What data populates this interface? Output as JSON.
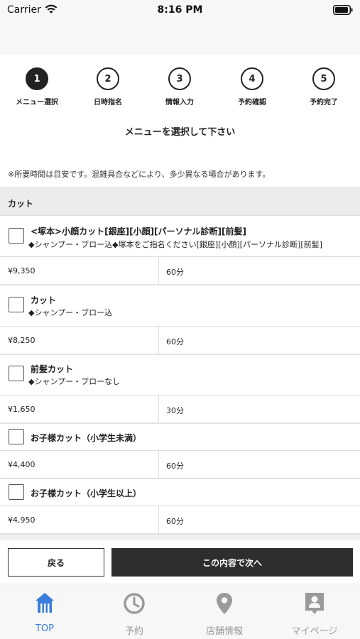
{
  "status_bar": {
    "carrier": "Carrier",
    "time": "8:16 PM"
  },
  "steps": [
    {
      "number": "1",
      "label": "メニュー選択",
      "active": true
    },
    {
      "number": "2",
      "label": "日時指名",
      "active": false
    },
    {
      "number": "3",
      "label": "情報入力",
      "active": false
    },
    {
      "number": "4",
      "label": "予約確認",
      "active": false
    },
    {
      "number": "5",
      "label": "予約完了",
      "active": false
    }
  ],
  "page_title": "メニューを選択して下さい",
  "note": "※所要時間は目安です。混雑具合などにより、多少異なる場合があります。",
  "category": "カット",
  "menu_items": [
    {
      "name": "<塚本>小顔カット[銀座][小顔][パーソナル診断][前髪]",
      "description": "◆シャンプー・ブロー込◆塚本をご指名ください[銀座][小顔][パーソナル診断][前髪]",
      "price": "¥9,350",
      "duration": "60分",
      "checked": false
    },
    {
      "name": "カット",
      "description": "◆シャンプー・ブロー込",
      "price": "¥8,250",
      "duration": "60分",
      "checked": false
    },
    {
      "name": "前髪カット",
      "description": "◆シャンプー・ブローなし",
      "price": "¥1,650",
      "duration": "30分",
      "checked": false
    },
    {
      "name": "お子様カット（小学生未満）",
      "description": "",
      "price": "¥4,400",
      "duration": "60分",
      "checked": false
    },
    {
      "name": "お子様カット（小学生以上）",
      "description": "",
      "price": "¥4,950",
      "duration": "60分",
      "checked": false
    }
  ],
  "buttons": {
    "back": "戻る",
    "next": "この内容で次へ"
  },
  "tab_bar": {
    "active_color": "#3b7ddd",
    "inactive_color": "#9a9a9a",
    "tabs": [
      {
        "label": "TOP",
        "icon": "home-icon",
        "active": true
      },
      {
        "label": "予約",
        "icon": "clock-icon",
        "active": false
      },
      {
        "label": "店舗情報",
        "icon": "map-pin-icon",
        "active": false
      },
      {
        "label": "マイページ",
        "icon": "user-icon",
        "active": false
      }
    ]
  }
}
